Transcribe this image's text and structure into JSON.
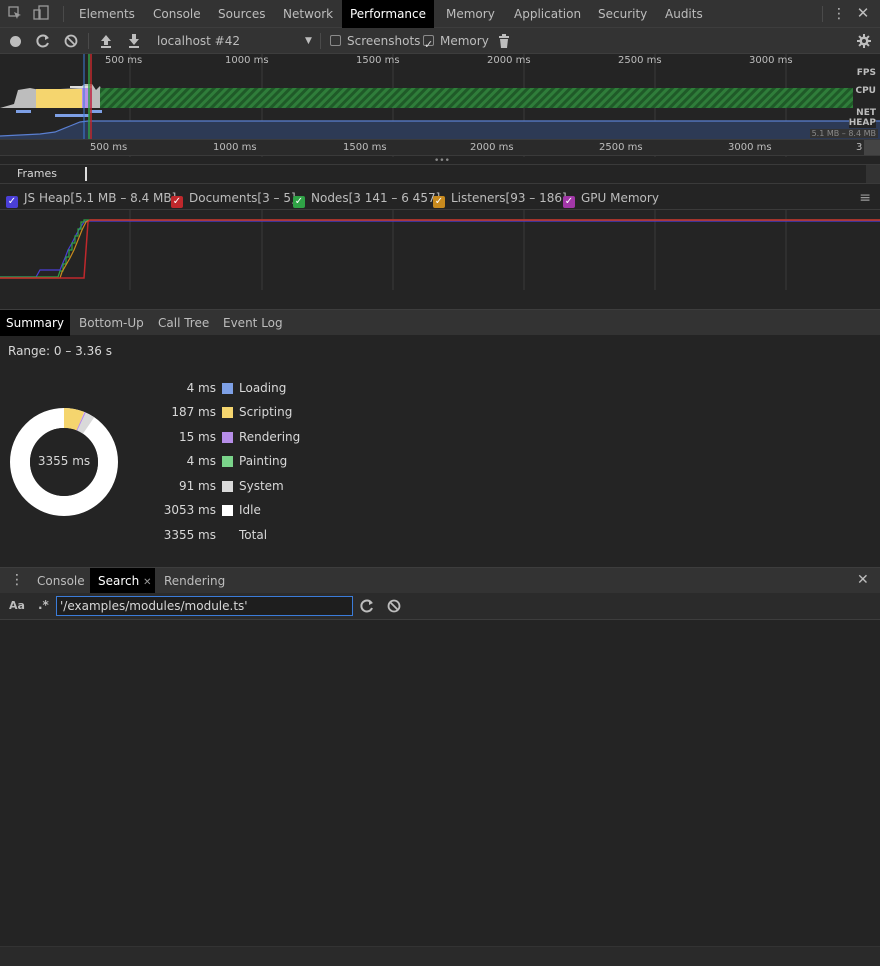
{
  "main_tabs": [
    "Elements",
    "Console",
    "Sources",
    "Network",
    "Performance",
    "Memory",
    "Application",
    "Security",
    "Audits"
  ],
  "active_main_tab": "Performance",
  "toolbar": {
    "profile_select": "localhost #42",
    "screenshots_label": "Screenshots",
    "memory_label": "Memory",
    "screenshots_checked": false,
    "memory_checked": true
  },
  "overview": {
    "top_ticks": [
      "500 ms",
      "1000 ms",
      "1500 ms",
      "2000 ms",
      "2500 ms",
      "3000 ms"
    ],
    "track_labels": {
      "fps": "FPS",
      "cpu": "CPU",
      "net": "NET",
      "heap": "HEAP"
    },
    "heap_range": "5.1 MB – 8.4 MB",
    "bottom_ticks": [
      "500 ms",
      "1000 ms",
      "1500 ms",
      "2000 ms",
      "2500 ms",
      "3000 ms",
      "3"
    ],
    "frames_label": "Frames"
  },
  "memory_legend": [
    {
      "label": "JS Heap[5.1 MB – 8.4 MB]",
      "color": "#4a3fd6",
      "checked": true
    },
    {
      "label": "Documents[3 – 5]",
      "color": "#c0282c",
      "checked": true
    },
    {
      "label": "Nodes[3 141 – 6 457]",
      "color": "#2fa246",
      "checked": true
    },
    {
      "label": "Listeners[93 – 186]",
      "color": "#c88a1e",
      "checked": true
    },
    {
      "label": "GPU Memory",
      "color": "#a237a8",
      "checked": true
    }
  ],
  "detail_tabs": [
    "Summary",
    "Bottom-Up",
    "Call Tree",
    "Event Log"
  ],
  "active_detail_tab": "Summary",
  "summary": {
    "range": "Range: 0 – 3.36 s",
    "total_center": "3355 ms",
    "rows": [
      {
        "value": "4 ms",
        "label": "Loading",
        "color": "#7ea0e6"
      },
      {
        "value": "187 ms",
        "label": "Scripting",
        "color": "#f5d56e"
      },
      {
        "value": "15 ms",
        "label": "Rendering",
        "color": "#b68ee8"
      },
      {
        "value": "4 ms",
        "label": "Painting",
        "color": "#7ad38a"
      },
      {
        "value": "91 ms",
        "label": "System",
        "color": "#d9d9d9"
      },
      {
        "value": "3053 ms",
        "label": "Idle",
        "color": "#ffffff"
      },
      {
        "value": "3355 ms",
        "label": "Total",
        "color": ""
      }
    ]
  },
  "drawer": {
    "tabs": [
      "Console",
      "Search",
      "Rendering"
    ],
    "active": "Search",
    "case_toggle": "Aa",
    "regex_toggle": ".*",
    "search_value": "'/examples/modules/module.ts'"
  }
}
